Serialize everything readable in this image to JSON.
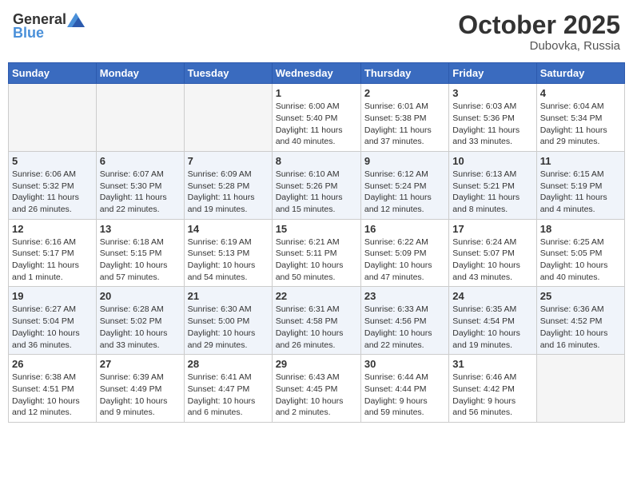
{
  "header": {
    "logo_general": "General",
    "logo_blue": "Blue",
    "month": "October 2025",
    "location": "Dubovka, Russia"
  },
  "weekdays": [
    "Sunday",
    "Monday",
    "Tuesday",
    "Wednesday",
    "Thursday",
    "Friday",
    "Saturday"
  ],
  "rows": [
    [
      {
        "day": "",
        "info": ""
      },
      {
        "day": "",
        "info": ""
      },
      {
        "day": "",
        "info": ""
      },
      {
        "day": "1",
        "info": "Sunrise: 6:00 AM\nSunset: 5:40 PM\nDaylight: 11 hours\nand 40 minutes."
      },
      {
        "day": "2",
        "info": "Sunrise: 6:01 AM\nSunset: 5:38 PM\nDaylight: 11 hours\nand 37 minutes."
      },
      {
        "day": "3",
        "info": "Sunrise: 6:03 AM\nSunset: 5:36 PM\nDaylight: 11 hours\nand 33 minutes."
      },
      {
        "day": "4",
        "info": "Sunrise: 6:04 AM\nSunset: 5:34 PM\nDaylight: 11 hours\nand 29 minutes."
      }
    ],
    [
      {
        "day": "5",
        "info": "Sunrise: 6:06 AM\nSunset: 5:32 PM\nDaylight: 11 hours\nand 26 minutes."
      },
      {
        "day": "6",
        "info": "Sunrise: 6:07 AM\nSunset: 5:30 PM\nDaylight: 11 hours\nand 22 minutes."
      },
      {
        "day": "7",
        "info": "Sunrise: 6:09 AM\nSunset: 5:28 PM\nDaylight: 11 hours\nand 19 minutes."
      },
      {
        "day": "8",
        "info": "Sunrise: 6:10 AM\nSunset: 5:26 PM\nDaylight: 11 hours\nand 15 minutes."
      },
      {
        "day": "9",
        "info": "Sunrise: 6:12 AM\nSunset: 5:24 PM\nDaylight: 11 hours\nand 12 minutes."
      },
      {
        "day": "10",
        "info": "Sunrise: 6:13 AM\nSunset: 5:21 PM\nDaylight: 11 hours\nand 8 minutes."
      },
      {
        "day": "11",
        "info": "Sunrise: 6:15 AM\nSunset: 5:19 PM\nDaylight: 11 hours\nand 4 minutes."
      }
    ],
    [
      {
        "day": "12",
        "info": "Sunrise: 6:16 AM\nSunset: 5:17 PM\nDaylight: 11 hours\nand 1 minute."
      },
      {
        "day": "13",
        "info": "Sunrise: 6:18 AM\nSunset: 5:15 PM\nDaylight: 10 hours\nand 57 minutes."
      },
      {
        "day": "14",
        "info": "Sunrise: 6:19 AM\nSunset: 5:13 PM\nDaylight: 10 hours\nand 54 minutes."
      },
      {
        "day": "15",
        "info": "Sunrise: 6:21 AM\nSunset: 5:11 PM\nDaylight: 10 hours\nand 50 minutes."
      },
      {
        "day": "16",
        "info": "Sunrise: 6:22 AM\nSunset: 5:09 PM\nDaylight: 10 hours\nand 47 minutes."
      },
      {
        "day": "17",
        "info": "Sunrise: 6:24 AM\nSunset: 5:07 PM\nDaylight: 10 hours\nand 43 minutes."
      },
      {
        "day": "18",
        "info": "Sunrise: 6:25 AM\nSunset: 5:05 PM\nDaylight: 10 hours\nand 40 minutes."
      }
    ],
    [
      {
        "day": "19",
        "info": "Sunrise: 6:27 AM\nSunset: 5:04 PM\nDaylight: 10 hours\nand 36 minutes."
      },
      {
        "day": "20",
        "info": "Sunrise: 6:28 AM\nSunset: 5:02 PM\nDaylight: 10 hours\nand 33 minutes."
      },
      {
        "day": "21",
        "info": "Sunrise: 6:30 AM\nSunset: 5:00 PM\nDaylight: 10 hours\nand 29 minutes."
      },
      {
        "day": "22",
        "info": "Sunrise: 6:31 AM\nSunset: 4:58 PM\nDaylight: 10 hours\nand 26 minutes."
      },
      {
        "day": "23",
        "info": "Sunrise: 6:33 AM\nSunset: 4:56 PM\nDaylight: 10 hours\nand 22 minutes."
      },
      {
        "day": "24",
        "info": "Sunrise: 6:35 AM\nSunset: 4:54 PM\nDaylight: 10 hours\nand 19 minutes."
      },
      {
        "day": "25",
        "info": "Sunrise: 6:36 AM\nSunset: 4:52 PM\nDaylight: 10 hours\nand 16 minutes."
      }
    ],
    [
      {
        "day": "26",
        "info": "Sunrise: 6:38 AM\nSunset: 4:51 PM\nDaylight: 10 hours\nand 12 minutes."
      },
      {
        "day": "27",
        "info": "Sunrise: 6:39 AM\nSunset: 4:49 PM\nDaylight: 10 hours\nand 9 minutes."
      },
      {
        "day": "28",
        "info": "Sunrise: 6:41 AM\nSunset: 4:47 PM\nDaylight: 10 hours\nand 6 minutes."
      },
      {
        "day": "29",
        "info": "Sunrise: 6:43 AM\nSunset: 4:45 PM\nDaylight: 10 hours\nand 2 minutes."
      },
      {
        "day": "30",
        "info": "Sunrise: 6:44 AM\nSunset: 4:44 PM\nDaylight: 9 hours\nand 59 minutes."
      },
      {
        "day": "31",
        "info": "Sunrise: 6:46 AM\nSunset: 4:42 PM\nDaylight: 9 hours\nand 56 minutes."
      },
      {
        "day": "",
        "info": ""
      }
    ]
  ]
}
